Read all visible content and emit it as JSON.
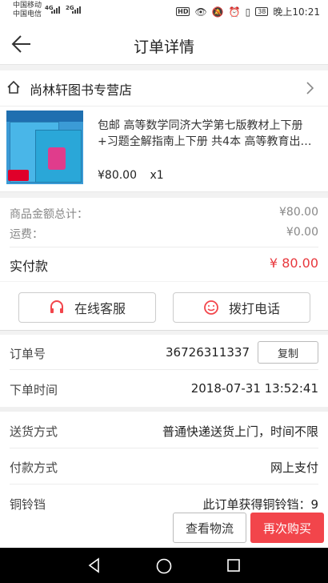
{
  "status_bar": {
    "carrier1": "中国移动",
    "carrier2": "中国电信",
    "net1": "4G",
    "net2": "2G",
    "hd": "HD",
    "battery": "38",
    "time": "晚上10:21"
  },
  "header": {
    "title": "订单详情"
  },
  "shop": {
    "name": "尚林轩图书专营店"
  },
  "product": {
    "description": "包邮 高等数学同济大学第七版教材上下册+习题全解指南上下册 共4本 高等教育出…",
    "price": "¥80.00",
    "qty": "x1"
  },
  "summary": {
    "goods_total_label": "商品金额总计：",
    "goods_total_value": "¥80.00",
    "shipping_label": "运费：",
    "shipping_value": "¥0.00",
    "paid_label": "实付款",
    "paid_value": "¥ 80.00"
  },
  "actions": {
    "service_label": "在线客服",
    "call_label": "拨打电话"
  },
  "info": {
    "order_no_label": "订单号",
    "order_no_value": "36726311337",
    "copy_label": "复制",
    "order_time_label": "下单时间",
    "order_time_value": "2018-07-31 13:52:41",
    "delivery_label": "送货方式",
    "delivery_value": "普通快递送货上门，时间不限",
    "payment_label": "付款方式",
    "payment_value": "网上支付",
    "bell_label": "铜铃铛",
    "bell_value": "此订单获得铜铃铛：9"
  },
  "bottom": {
    "logistics_label": "查看物流",
    "rebuy_label": "再次购买"
  },
  "colors": {
    "accent": "#f2454b",
    "price_red": "#e8383d"
  }
}
